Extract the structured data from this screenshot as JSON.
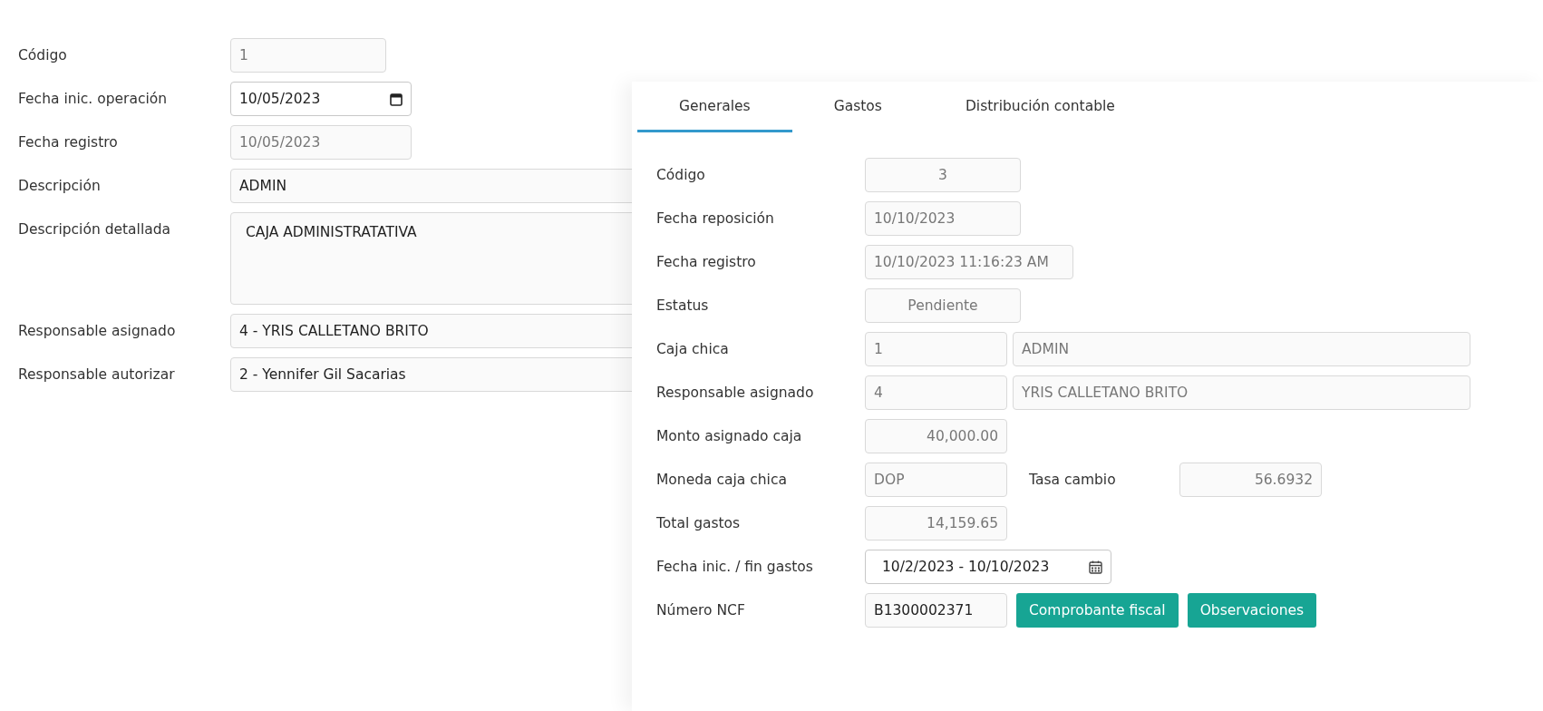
{
  "main_form": {
    "fields": [
      {
        "label": "Código",
        "value": "1",
        "kind": "text",
        "disabled": true
      },
      {
        "label": "Fecha inic. operación",
        "value": "10/05/2023",
        "kind": "date",
        "disabled": false
      },
      {
        "label": "Fecha registro",
        "value": "10/05/2023",
        "kind": "text",
        "disabled": true
      },
      {
        "label": "Descripción",
        "value": "ADMIN",
        "kind": "text",
        "disabled": false
      },
      {
        "label": "Descripción detallada",
        "value": "CAJA ADMINISTRATATIVA",
        "kind": "textarea",
        "disabled": false
      },
      {
        "label": "Responsable asignado",
        "value": "4 - YRIS CALLETANO BRITO",
        "kind": "text",
        "disabled": false
      },
      {
        "label": "Responsable autorizar",
        "value": "2 - Yennifer Gil Sacarias",
        "kind": "text",
        "disabled": false
      }
    ]
  },
  "panel": {
    "tabs": [
      {
        "label": "Generales",
        "selected": true
      },
      {
        "label": "Gastos",
        "selected": false
      },
      {
        "label": "Distribución contable",
        "selected": false
      }
    ],
    "rows": [
      {
        "label": "Código",
        "items": [
          {
            "kind": "input",
            "value": "3",
            "disabled": true
          }
        ]
      },
      {
        "label": "Fecha reposición",
        "items": [
          {
            "kind": "input",
            "value": "10/10/2023",
            "disabled": true
          }
        ]
      },
      {
        "label": "Fecha registro",
        "items": [
          {
            "kind": "input",
            "value": "10/10/2023 11:16:23 AM",
            "disabled": true
          }
        ]
      },
      {
        "label": "Estatus",
        "items": [
          {
            "kind": "input",
            "value": "Pendiente",
            "disabled": true
          }
        ]
      },
      {
        "label": "Caja chica",
        "items": [
          {
            "kind": "input",
            "value": "1",
            "disabled": true
          },
          {
            "kind": "input",
            "value": "ADMIN",
            "disabled": true
          }
        ]
      },
      {
        "label": "Responsable asignado",
        "items": [
          {
            "kind": "input",
            "value": "4",
            "disabled": true
          },
          {
            "kind": "input",
            "value": "YRIS CALLETANO BRITO",
            "disabled": true
          }
        ]
      },
      {
        "label": "Monto asignado caja",
        "items": [
          {
            "kind": "input",
            "value": "40,000.00",
            "disabled": true
          }
        ]
      },
      {
        "label": "Moneda caja chica",
        "items": [
          {
            "kind": "input",
            "value": "DOP",
            "disabled": true
          },
          {
            "kind": "label",
            "value": "Tasa cambio"
          },
          {
            "kind": "input",
            "value": "56.6932",
            "disabled": true
          }
        ]
      },
      {
        "label": "Total gastos",
        "items": [
          {
            "kind": "input",
            "value": "14,159.65",
            "disabled": true
          }
        ]
      },
      {
        "label": "Fecha inic. / fin gastos",
        "items": [
          {
            "kind": "date",
            "value": "10/2/2023 - 10/10/2023",
            "disabled": false
          }
        ]
      },
      {
        "label": "Número NCF",
        "items": [
          {
            "kind": "input",
            "value": "B1300002371",
            "disabled": false
          },
          {
            "kind": "button",
            "value": "Comprobante fiscal"
          },
          {
            "kind": "button",
            "value": "Observaciones"
          }
        ]
      }
    ]
  }
}
